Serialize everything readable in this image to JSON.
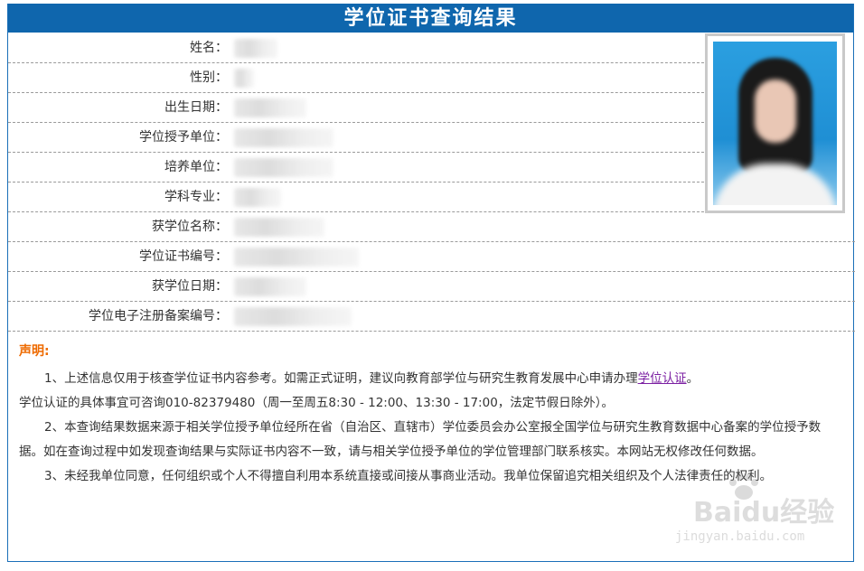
{
  "page": {
    "title": "学位证书查询结果"
  },
  "fields": [
    {
      "label": "姓名："
    },
    {
      "label": "性别："
    },
    {
      "label": "出生日期："
    },
    {
      "label": "学位授予单位："
    },
    {
      "label": "培养单位："
    },
    {
      "label": "学科专业："
    },
    {
      "label": "获学位名称："
    },
    {
      "label": "学位证书编号："
    },
    {
      "label": "获学位日期："
    },
    {
      "label": "学位电子注册备案编号："
    }
  ],
  "declaration": {
    "title": "声明:",
    "p1_before_link": "1、上述信息仅用于核查学位证书内容参考。如需正式证明，建议向教育部学位与研究生教育发展中心申请办理",
    "p1_link": "学位认证",
    "p1_after_link": "。",
    "p1_line2": "学位认证的具体事宜可咨询010-82379480（周一至周五8:30 - 12:00、13:30 - 17:00，法定节假日除外）。",
    "p2": "2、本查询结果数据来源于相关学位授予单位经所在省（自治区、直辖市）学位委员会办公室报全国学位与研究生教育数据中心备案的学位授予数据。如在查询过程中如发现查询结果与实际证书内容不一致，请与相关学位授予单位的学位管理部门联系核实。本网站无权修改任何数据。",
    "p3": "3、未经我单位同意，任何组织或个人不得擅自利用本系统直接或间接从事商业活动。我单位保留追究相关组织及个人法律责任的权利。"
  },
  "watermark": {
    "main": "Baidu经验",
    "sub": "jingyan.baidu.com"
  },
  "colors": {
    "title_bar": "#0f66ad",
    "declaration_title": "#ee6a00",
    "link": "#7b1fa2"
  }
}
